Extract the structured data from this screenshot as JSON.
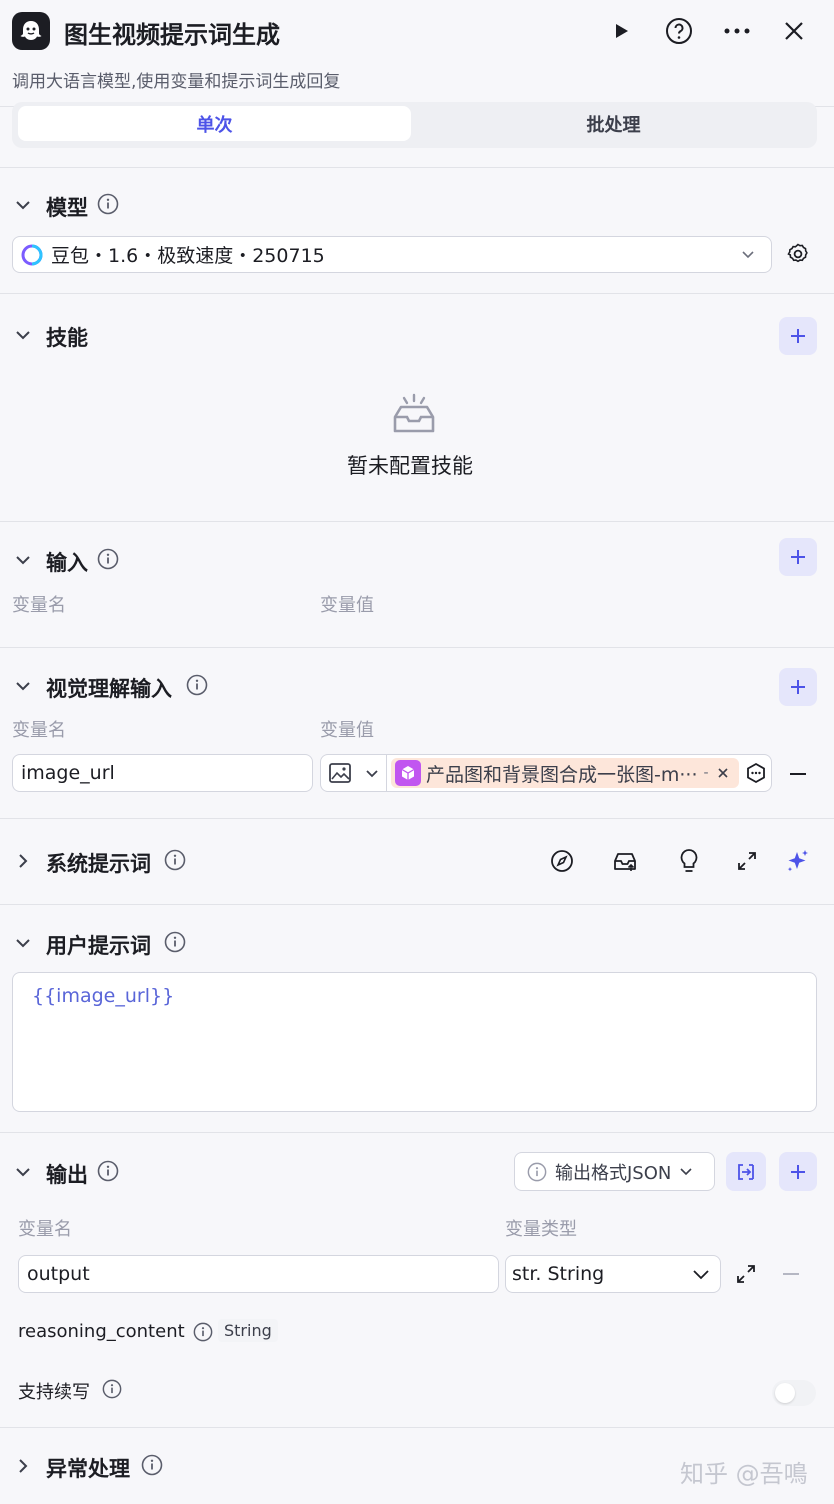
{
  "header": {
    "title": "图生视频提示词生成",
    "subtitle": "调用大语言模型,使用变量和提示词生成回复"
  },
  "mode_tabs": {
    "single": "单次",
    "batch": "批处理"
  },
  "model": {
    "title": "模型",
    "value": "豆包・1.6・极致速度・250715"
  },
  "skills": {
    "title": "技能",
    "empty": "暂未配置技能"
  },
  "input": {
    "title": "输入",
    "col_name": "变量名",
    "col_value": "变量值"
  },
  "vision_input": {
    "title": "视觉理解输入",
    "col_name": "变量名",
    "col_value": "变量值",
    "var_name": "image_url",
    "ref_label": "产品图和背景图合成一张图-m···",
    "ref_sep": "-"
  },
  "system_prompt": {
    "title": "系统提示词"
  },
  "user_prompt": {
    "title": "用户提示词",
    "content": "{{image_url}}"
  },
  "output": {
    "title": "输出",
    "format_label": "输出格式JSON",
    "col_name": "变量名",
    "col_type": "变量类型",
    "var_name": "output",
    "var_type": "str. String",
    "reasoning_label": "reasoning_content",
    "reasoning_type": "String",
    "continue_label": "支持续写",
    "continue_enabled": false
  },
  "exception": {
    "title": "异常处理"
  },
  "watermark": "知乎 @吾鳴",
  "colors": {
    "accent": "#4d53e8",
    "plus_bg": "#e5e6fb",
    "ref_bg": "#fde6da",
    "ref_icon": "#c156f0"
  }
}
